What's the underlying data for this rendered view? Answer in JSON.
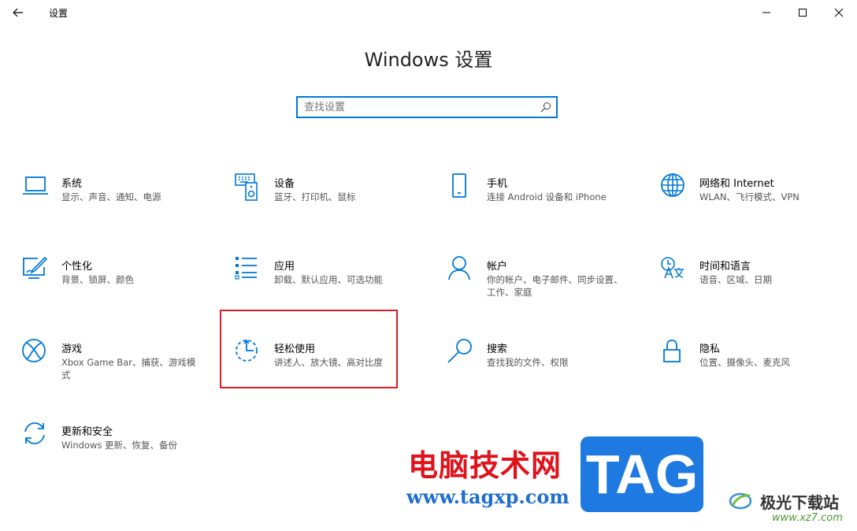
{
  "window": {
    "title": "设置"
  },
  "header": {
    "heading": "Windows 设置"
  },
  "search": {
    "placeholder": "查找设置",
    "value": ""
  },
  "accent_color": "#0078d7",
  "highlight_color": "#e01b24",
  "tiles": [
    {
      "title": "系统",
      "desc": "显示、声音、通知、电源",
      "icon": "laptop-icon"
    },
    {
      "title": "设备",
      "desc": "蓝牙、打印机、鼠标",
      "icon": "keyboard-speaker-icon"
    },
    {
      "title": "手机",
      "desc": "连接 Android 设备和 iPhone",
      "icon": "phone-icon"
    },
    {
      "title": "网络和 Internet",
      "desc": "WLAN、飞行模式、VPN",
      "icon": "globe-icon"
    },
    {
      "title": "个性化",
      "desc": "背景、锁屏、颜色",
      "icon": "paint-icon"
    },
    {
      "title": "应用",
      "desc": "卸载、默认应用、可选功能",
      "icon": "app-list-icon"
    },
    {
      "title": "帐户",
      "desc": "你的帐户、电子邮件、同步设置、工作、家庭",
      "icon": "person-icon"
    },
    {
      "title": "时间和语言",
      "desc": "语音、区域、日期",
      "icon": "time-language-icon"
    },
    {
      "title": "游戏",
      "desc": "Xbox Game Bar、捕获、游戏模式",
      "icon": "xbox-icon"
    },
    {
      "title": "轻松使用",
      "desc": "讲述人、放大镜、高对比度",
      "icon": "ease-of-access-icon"
    },
    {
      "title": "搜索",
      "desc": "查找我的文件、权限",
      "icon": "search-icon"
    },
    {
      "title": "隐私",
      "desc": "位置、摄像头、麦克风",
      "icon": "lock-icon"
    },
    {
      "title": "更新和安全",
      "desc": "Windows 更新、恢复、备份",
      "icon": "sync-icon"
    }
  ],
  "watermark": {
    "site_name": "电脑技术网",
    "site_url": "www.tagxp.com",
    "tag_text": "TAG",
    "logo_text": "极光下载站",
    "logo_url": "www.xz7.com"
  }
}
